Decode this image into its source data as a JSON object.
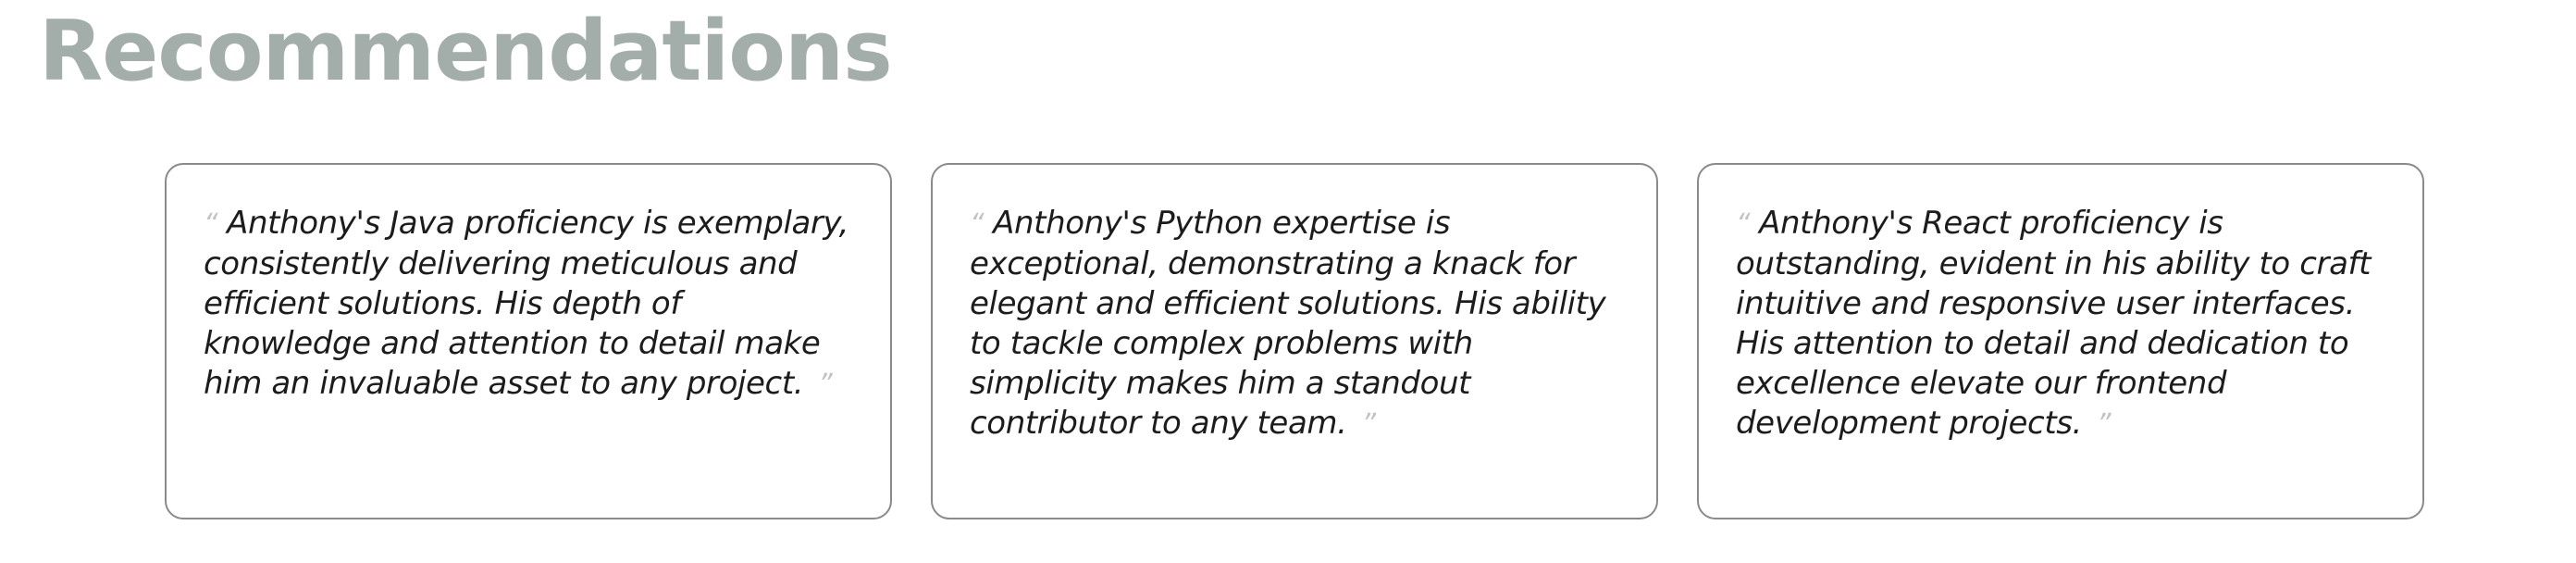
{
  "section": {
    "title": "Recommendations"
  },
  "recommendations": [
    {
      "open_quote": "“",
      "text": "Anthony's Java proficiency is exemplary, consistently delivering meticulous and efficient solutions. His depth of knowledge and attention to detail make him an invaluable asset to any project.",
      "close_quote": "”"
    },
    {
      "open_quote": "“",
      "text": "Anthony's Python expertise is exceptional, demonstrating a knack for elegant and efficient solutions. His ability to tackle complex problems with simplicity makes him a standout contributor to any team.",
      "close_quote": "”"
    },
    {
      "open_quote": "“",
      "text": "Anthony's React proficiency is outstanding, evident in his ability to craft intuitive and responsive user interfaces. His attention to detail and dedication to excellence elevate our frontend development projects.",
      "close_quote": "”"
    }
  ],
  "colors": {
    "title": "#a3adaa",
    "card_border": "#8a8a8a",
    "quote_mark": "#c2c2c2",
    "text": "#1c1c1c"
  }
}
